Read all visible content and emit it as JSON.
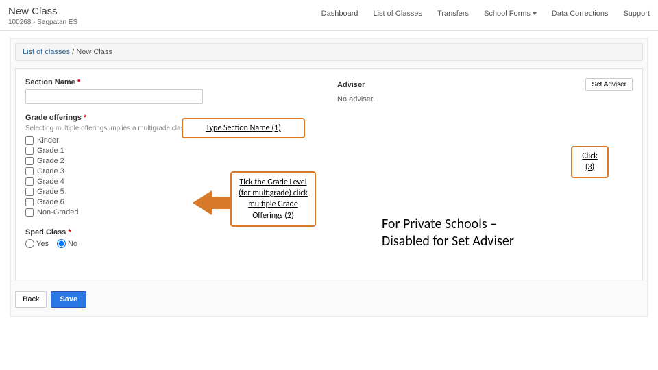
{
  "topbar": {
    "title": "New Class",
    "subtitle": "100268 - Sagpatan ES",
    "nav": [
      "Dashboard",
      "List of Classes",
      "Transfers",
      "School Forms",
      "Data Corrections",
      "Support"
    ]
  },
  "breadcrumb": {
    "link": "List of classes",
    "sep": " / ",
    "current": "New Class"
  },
  "form": {
    "section_label": "Section Name",
    "grade_label": "Grade offerings",
    "grade_hint": "Selecting multiple offerings implies a multigrade class",
    "grades": [
      "Kinder",
      "Grade 1",
      "Grade 2",
      "Grade 3",
      "Grade 4",
      "Grade 5",
      "Grade 6",
      "Non-Graded"
    ],
    "sped_label": "Sped Class",
    "sped_yes": "Yes",
    "sped_no": "No",
    "adviser_label": "Adviser",
    "set_adviser_btn": "Set Adviser",
    "no_adviser": "No adviser.",
    "back": "Back",
    "save": "Save",
    "req": "*"
  },
  "callouts": {
    "c1": "Type Section Name (1)",
    "c2": "Tick the Grade Level (for multigrade) click multiple Grade Offerings (2)",
    "c3": "Click (3)"
  },
  "annotation": {
    "line1": "For Private Schools –",
    "line2": "Disabled for Set Adviser"
  }
}
